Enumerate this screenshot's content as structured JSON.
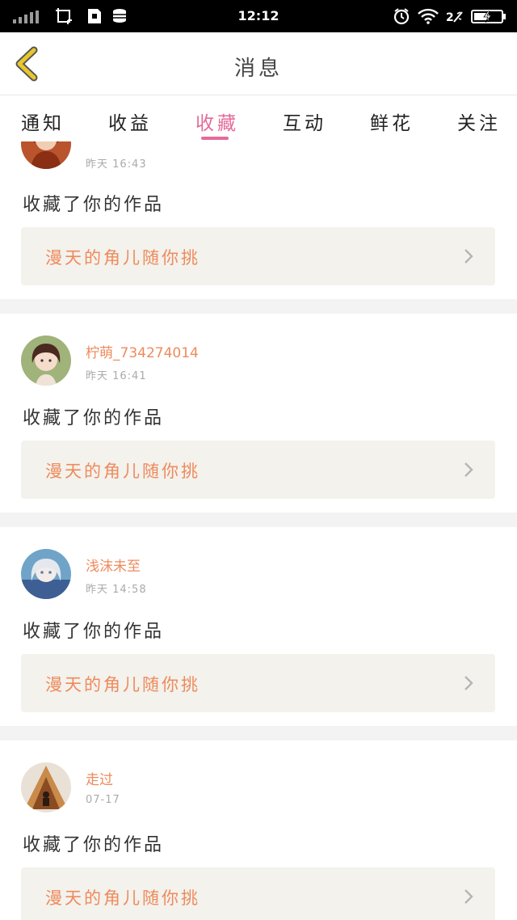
{
  "status_bar": {
    "time": "12:12",
    "icons": [
      "signal-icon",
      "screenshot-icon",
      "sim-icon",
      "storage-icon",
      "alarm-icon",
      "wifi-icon",
      "network-icon",
      "battery-icon"
    ]
  },
  "header": {
    "title": "消息",
    "back_icon": "chevron-left-icon"
  },
  "tabs": [
    {
      "label": "通知",
      "active": false
    },
    {
      "label": "收益",
      "active": false
    },
    {
      "label": "收藏",
      "active": true
    },
    {
      "label": "互动",
      "active": false
    },
    {
      "label": "鲜花",
      "active": false
    },
    {
      "label": "关注",
      "active": false
    }
  ],
  "items": [
    {
      "username": "",
      "time": "昨天 16:43",
      "action": "收藏了你的作品",
      "work_title": "漫天的角儿随你挑"
    },
    {
      "username": "柠萌_734274014",
      "time": "昨天 16:41",
      "action": "收藏了你的作品",
      "work_title": "漫天的角儿随你挑"
    },
    {
      "username": "浅沫未至",
      "time": "昨天 14:58",
      "action": "收藏了你的作品",
      "work_title": "漫天的角儿随你挑"
    },
    {
      "username": "走过",
      "time": "07-17",
      "action": "收藏了你的作品",
      "work_title": "漫天的角儿随你挑"
    }
  ],
  "colors": {
    "accent": "#e36b9a",
    "username": "#ef8a5c",
    "link_bg": "#f3f2ed",
    "back_icon": "#e8c62e"
  }
}
